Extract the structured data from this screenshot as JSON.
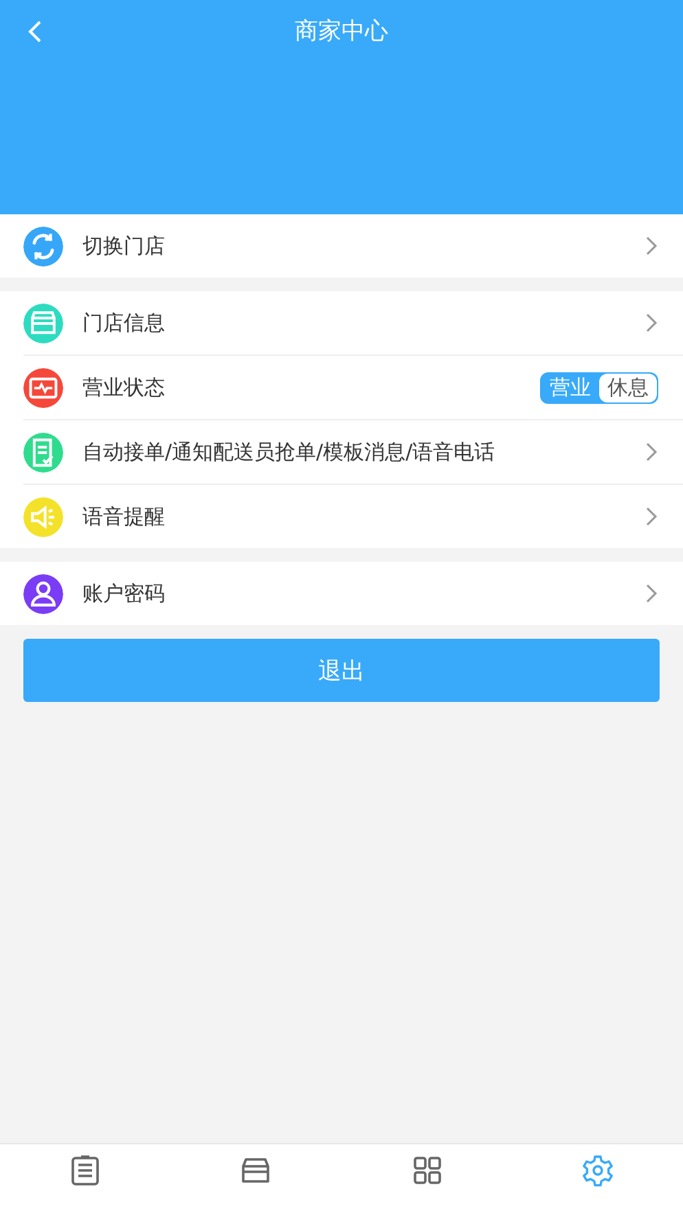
{
  "header": {
    "title": "商家中心"
  },
  "groups": [
    {
      "items": [
        {
          "kind": "link",
          "label": "切换门店",
          "color": "#36a6f8"
        }
      ]
    },
    {
      "items": [
        {
          "kind": "link",
          "label": "门店信息",
          "color": "#2ddcc0"
        },
        {
          "kind": "toggle",
          "label": "营业状态",
          "color": "#f5483a",
          "options": [
            {
              "label": "营业",
              "selected": true
            },
            {
              "label": "休息",
              "selected": false
            }
          ]
        },
        {
          "kind": "link",
          "label": "自动接单/通知配送员抢单/模板消息/语音电话",
          "color": "#2fdc8e"
        },
        {
          "kind": "link",
          "label": "语音提醒",
          "color": "#f4e22a"
        }
      ]
    },
    {
      "items": [
        {
          "kind": "link",
          "label": "账户密码",
          "color": "#7b3cf5"
        }
      ]
    }
  ],
  "logout": {
    "label": "退出"
  },
  "tabbar": [
    {
      "selected": false
    },
    {
      "selected": false
    },
    {
      "selected": false
    },
    {
      "selected": true
    }
  ]
}
